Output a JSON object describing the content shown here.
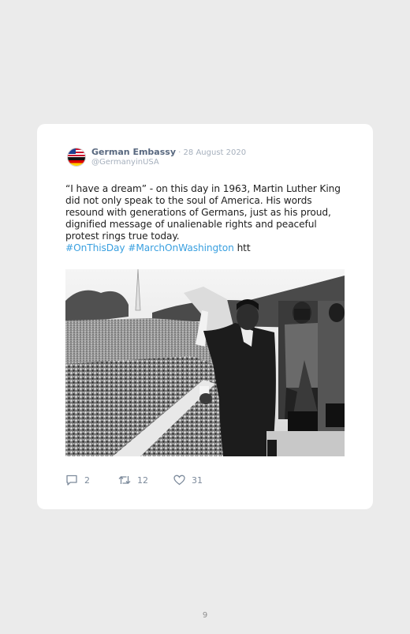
{
  "tweet": {
    "author_name": "German Embassy",
    "separator": " · ",
    "date": "28 August 2020",
    "handle": "@GermanyinUSA",
    "body": "“I have a dream” - on this day in 1963, Martin Luther King did not only speak to the soul of America. His words resound with generations of Germans, just as his proud, dignified message of unalienable rights and peaceful protest rings true today.",
    "hashtags": [
      "#OnThisDay",
      "#MarchOnWashington"
    ],
    "link_stub": "htt",
    "image_icon": "black-and-white-photo-icon",
    "avatar_icon": "us-german-flags-avatar-icon"
  },
  "actions": {
    "replies": {
      "icon": "reply-bubble-icon",
      "count": "2"
    },
    "retweets": {
      "icon": "retweet-icon",
      "count": "12"
    },
    "likes": {
      "icon": "heart-icon",
      "count": "31"
    }
  },
  "page": {
    "number": "9"
  },
  "colors": {
    "background": "#ebebeb",
    "card": "#ffffff",
    "name": "#58687f",
    "meta": "#a6b0bd",
    "hashtag": "#3aa0e0",
    "action": "#7c8a9b"
  }
}
